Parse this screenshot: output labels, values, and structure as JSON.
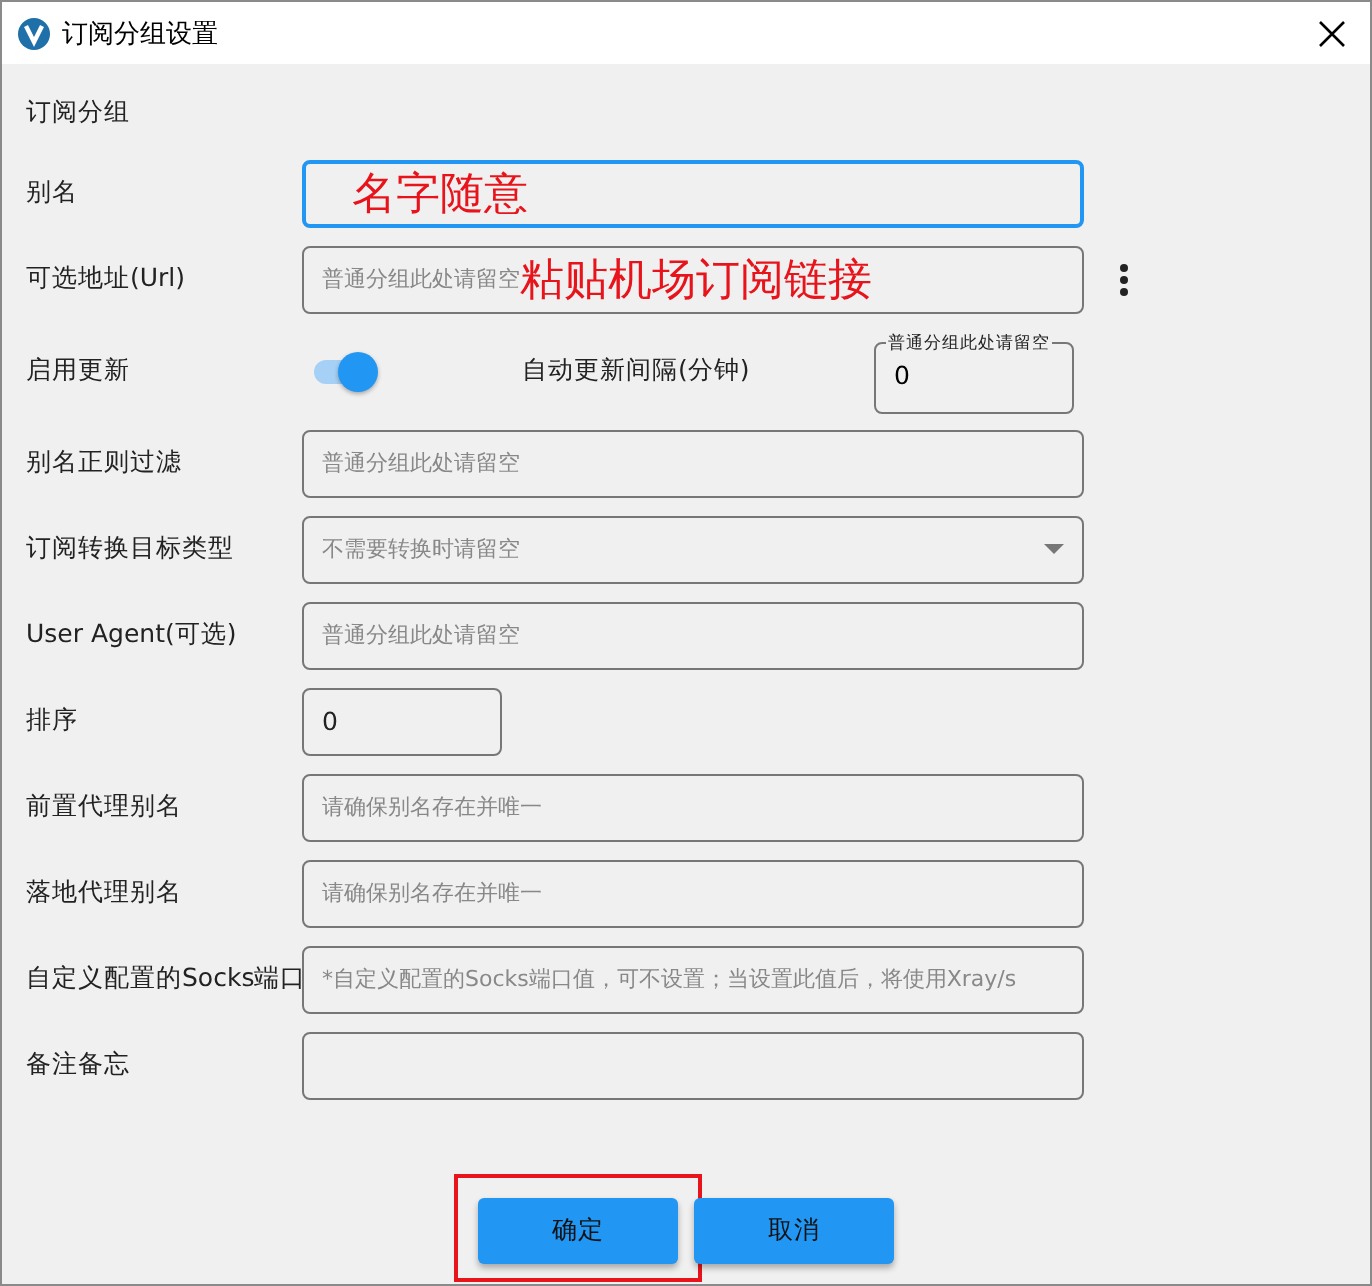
{
  "window": {
    "title": "订阅分组设置"
  },
  "section": "订阅分组",
  "rows": [
    {
      "kind": "text",
      "label": "别名",
      "focused": true,
      "annotation": "名字随意"
    },
    {
      "kind": "text",
      "label": "可选地址(Url)",
      "focused": false,
      "placeholder": "普通分组此处请留空",
      "annotation": "粘贴机场订阅链接",
      "menu": true
    },
    {
      "kind": "switch",
      "label": "启用更新",
      "on": true,
      "interval_label": "自动更新间隔(分钟)",
      "interval_caption": "普通分组此处请留空",
      "interval_value": "0"
    },
    {
      "kind": "text",
      "label": "别名正则过滤",
      "focused": false,
      "placeholder": "普通分组此处请留空"
    },
    {
      "kind": "select",
      "label": "订阅转换目标类型",
      "placeholder": "不需要转换时请留空"
    },
    {
      "kind": "text",
      "label": "User Agent(可选)",
      "focused": false,
      "placeholder": "普通分组此处请留空"
    },
    {
      "kind": "number",
      "label": "排序",
      "value": "0"
    },
    {
      "kind": "text",
      "label": "前置代理别名",
      "focused": false,
      "placeholder": "请确保别名存在并唯一"
    },
    {
      "kind": "text",
      "label": "落地代理别名",
      "focused": false,
      "placeholder": "请确保别名存在并唯一"
    },
    {
      "kind": "text",
      "label": "自定义配置的Socks端口",
      "focused": false,
      "placeholder": "*自定义配置的Socks端口值，可不设置；当设置此值后，将使用Xray/s"
    },
    {
      "kind": "text",
      "label": "备注备忘",
      "focused": false
    }
  ],
  "buttons": [
    {
      "label": "确定",
      "highlighted": true
    },
    {
      "label": "取消",
      "highlighted": false
    }
  ]
}
